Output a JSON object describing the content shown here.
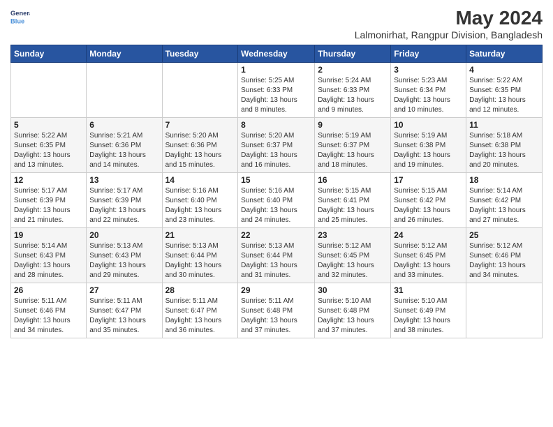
{
  "header": {
    "logo_line1": "General",
    "logo_line2": "Blue",
    "title": "May 2024",
    "subtitle": "Lalmonirhat, Rangpur Division, Bangladesh"
  },
  "days_of_week": [
    "Sunday",
    "Monday",
    "Tuesday",
    "Wednesday",
    "Thursday",
    "Friday",
    "Saturday"
  ],
  "weeks": [
    [
      {
        "num": "",
        "info": ""
      },
      {
        "num": "",
        "info": ""
      },
      {
        "num": "",
        "info": ""
      },
      {
        "num": "1",
        "info": "Sunrise: 5:25 AM\nSunset: 6:33 PM\nDaylight: 13 hours\nand 8 minutes."
      },
      {
        "num": "2",
        "info": "Sunrise: 5:24 AM\nSunset: 6:33 PM\nDaylight: 13 hours\nand 9 minutes."
      },
      {
        "num": "3",
        "info": "Sunrise: 5:23 AM\nSunset: 6:34 PM\nDaylight: 13 hours\nand 10 minutes."
      },
      {
        "num": "4",
        "info": "Sunrise: 5:22 AM\nSunset: 6:35 PM\nDaylight: 13 hours\nand 12 minutes."
      }
    ],
    [
      {
        "num": "5",
        "info": "Sunrise: 5:22 AM\nSunset: 6:35 PM\nDaylight: 13 hours\nand 13 minutes."
      },
      {
        "num": "6",
        "info": "Sunrise: 5:21 AM\nSunset: 6:36 PM\nDaylight: 13 hours\nand 14 minutes."
      },
      {
        "num": "7",
        "info": "Sunrise: 5:20 AM\nSunset: 6:36 PM\nDaylight: 13 hours\nand 15 minutes."
      },
      {
        "num": "8",
        "info": "Sunrise: 5:20 AM\nSunset: 6:37 PM\nDaylight: 13 hours\nand 16 minutes."
      },
      {
        "num": "9",
        "info": "Sunrise: 5:19 AM\nSunset: 6:37 PM\nDaylight: 13 hours\nand 18 minutes."
      },
      {
        "num": "10",
        "info": "Sunrise: 5:19 AM\nSunset: 6:38 PM\nDaylight: 13 hours\nand 19 minutes."
      },
      {
        "num": "11",
        "info": "Sunrise: 5:18 AM\nSunset: 6:38 PM\nDaylight: 13 hours\nand 20 minutes."
      }
    ],
    [
      {
        "num": "12",
        "info": "Sunrise: 5:17 AM\nSunset: 6:39 PM\nDaylight: 13 hours\nand 21 minutes."
      },
      {
        "num": "13",
        "info": "Sunrise: 5:17 AM\nSunset: 6:39 PM\nDaylight: 13 hours\nand 22 minutes."
      },
      {
        "num": "14",
        "info": "Sunrise: 5:16 AM\nSunset: 6:40 PM\nDaylight: 13 hours\nand 23 minutes."
      },
      {
        "num": "15",
        "info": "Sunrise: 5:16 AM\nSunset: 6:40 PM\nDaylight: 13 hours\nand 24 minutes."
      },
      {
        "num": "16",
        "info": "Sunrise: 5:15 AM\nSunset: 6:41 PM\nDaylight: 13 hours\nand 25 minutes."
      },
      {
        "num": "17",
        "info": "Sunrise: 5:15 AM\nSunset: 6:42 PM\nDaylight: 13 hours\nand 26 minutes."
      },
      {
        "num": "18",
        "info": "Sunrise: 5:14 AM\nSunset: 6:42 PM\nDaylight: 13 hours\nand 27 minutes."
      }
    ],
    [
      {
        "num": "19",
        "info": "Sunrise: 5:14 AM\nSunset: 6:43 PM\nDaylight: 13 hours\nand 28 minutes."
      },
      {
        "num": "20",
        "info": "Sunrise: 5:13 AM\nSunset: 6:43 PM\nDaylight: 13 hours\nand 29 minutes."
      },
      {
        "num": "21",
        "info": "Sunrise: 5:13 AM\nSunset: 6:44 PM\nDaylight: 13 hours\nand 30 minutes."
      },
      {
        "num": "22",
        "info": "Sunrise: 5:13 AM\nSunset: 6:44 PM\nDaylight: 13 hours\nand 31 minutes."
      },
      {
        "num": "23",
        "info": "Sunrise: 5:12 AM\nSunset: 6:45 PM\nDaylight: 13 hours\nand 32 minutes."
      },
      {
        "num": "24",
        "info": "Sunrise: 5:12 AM\nSunset: 6:45 PM\nDaylight: 13 hours\nand 33 minutes."
      },
      {
        "num": "25",
        "info": "Sunrise: 5:12 AM\nSunset: 6:46 PM\nDaylight: 13 hours\nand 34 minutes."
      }
    ],
    [
      {
        "num": "26",
        "info": "Sunrise: 5:11 AM\nSunset: 6:46 PM\nDaylight: 13 hours\nand 34 minutes."
      },
      {
        "num": "27",
        "info": "Sunrise: 5:11 AM\nSunset: 6:47 PM\nDaylight: 13 hours\nand 35 minutes."
      },
      {
        "num": "28",
        "info": "Sunrise: 5:11 AM\nSunset: 6:47 PM\nDaylight: 13 hours\nand 36 minutes."
      },
      {
        "num": "29",
        "info": "Sunrise: 5:11 AM\nSunset: 6:48 PM\nDaylight: 13 hours\nand 37 minutes."
      },
      {
        "num": "30",
        "info": "Sunrise: 5:10 AM\nSunset: 6:48 PM\nDaylight: 13 hours\nand 37 minutes."
      },
      {
        "num": "31",
        "info": "Sunrise: 5:10 AM\nSunset: 6:49 PM\nDaylight: 13 hours\nand 38 minutes."
      },
      {
        "num": "",
        "info": ""
      }
    ]
  ]
}
